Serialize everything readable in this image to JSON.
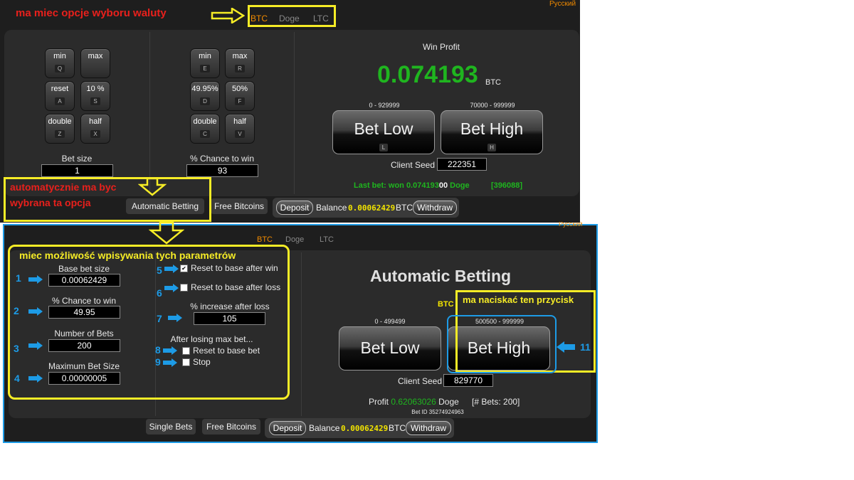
{
  "top": {
    "language": "Русский",
    "tabs": [
      "BTC",
      "Doge",
      "LTC"
    ],
    "left_keys": [
      {
        "label": "min",
        "key": "Q"
      },
      {
        "label": "max",
        "key": ""
      },
      {
        "label": "reset",
        "key": "A"
      },
      {
        "label": "10 %",
        "key": "S"
      },
      {
        "label": "double",
        "key": "Z"
      },
      {
        "label": "half",
        "key": "X"
      }
    ],
    "mid_keys": [
      {
        "label": "min",
        "key": "E"
      },
      {
        "label": "max",
        "key": "R"
      },
      {
        "label": "49.95%",
        "key": "D"
      },
      {
        "label": "50%",
        "key": "F"
      },
      {
        "label": "double",
        "key": "C"
      },
      {
        "label": "half",
        "key": "V"
      }
    ],
    "bet_size_label": "Bet size",
    "bet_size_value": "1",
    "chance_label": "% Chance to win",
    "chance_value": "93",
    "win_profit_label": "Win Profit",
    "win_profit_value": "0.074193",
    "win_profit_unit": "BTC",
    "bet_low_range": "0 - 929999",
    "bet_high_range": "70000 - 999999",
    "bet_low": "Bet Low",
    "bet_high": "Bet High",
    "bet_low_key": "L",
    "bet_high_key": "H",
    "client_seed_label": "Client Seed",
    "client_seed_value": "222351",
    "last_bet_a": "Last bet: won 0.074193",
    "last_bet_b": "00",
    "last_bet_c": " Doge",
    "last_bet_id": "[396088]",
    "auto_betting_btn": "Automatic Betting",
    "free_bitcoins_btn": "Free Bitcoins",
    "deposit_btn": "Deposit",
    "balance_label": "Balance",
    "balance_value": "0.00062429",
    "balance_unit": "BTC",
    "withdraw_btn": "Withdraw"
  },
  "bottom": {
    "language_partial": "Русский",
    "tabs": [
      "BTC",
      "Doge",
      "LTC"
    ],
    "base_bet_label": "Base bet size",
    "base_bet_value": "0.00062429",
    "chance_label": "% Chance to win",
    "chance_value": "49.95",
    "num_bets_label": "Number of Bets",
    "num_bets_value": "200",
    "max_bet_label": "Maximum Bet Size",
    "max_bet_value": "0.00000005",
    "reset_win_label": "Reset to base after win",
    "reset_loss_label": "Reset to base after loss",
    "increase_label": "% increase after loss",
    "increase_value": "105",
    "after_losing_label": "After losing max bet...",
    "reset_base_label": "Reset to base bet",
    "stop_label": "Stop",
    "title": "Automatic Betting",
    "currency": "BTC",
    "bet_low_range": "0 - 499499",
    "bet_high_range": "500500 - 999999",
    "bet_low": "Bet Low",
    "bet_high": "Bet High",
    "client_seed_label": "Client Seed",
    "client_seed_value": "829770",
    "profit_label": "Profit",
    "profit_value": "0.62063026",
    "profit_unit": "Doge",
    "bets_count": "[# Bets: 200]",
    "bet_id": "Bet ID 35274924963",
    "single_bets_btn": "Single Bets",
    "free_bitcoins_btn": "Free Bitcoins",
    "deposit_btn": "Deposit",
    "balance_label": "Balance",
    "balance_value": "0.00062429",
    "balance_unit": "BTC",
    "withdraw_btn": "Withdraw"
  },
  "annotations": {
    "currency_note": "ma miec opcje wyboru waluty",
    "auto_note_line1": "automatycznie ma byc",
    "auto_note_line2": "wybrana ta opcja",
    "params_note": "miec możliwość wpisywania tych parametrów",
    "click_note": "ma naciskać ten przycisk",
    "numbers": [
      "1",
      "2",
      "3",
      "4",
      "5",
      "6",
      "7",
      "8",
      "9",
      "11"
    ]
  },
  "colors": {
    "annotation_red": "#e8201c",
    "annotation_yellow": "#f6ec26",
    "annotation_blue": "#1d9be6",
    "profit_green": "#1fb51f",
    "balance_yellow": "#f2e400",
    "tab_active_orange": "#f08a00"
  }
}
